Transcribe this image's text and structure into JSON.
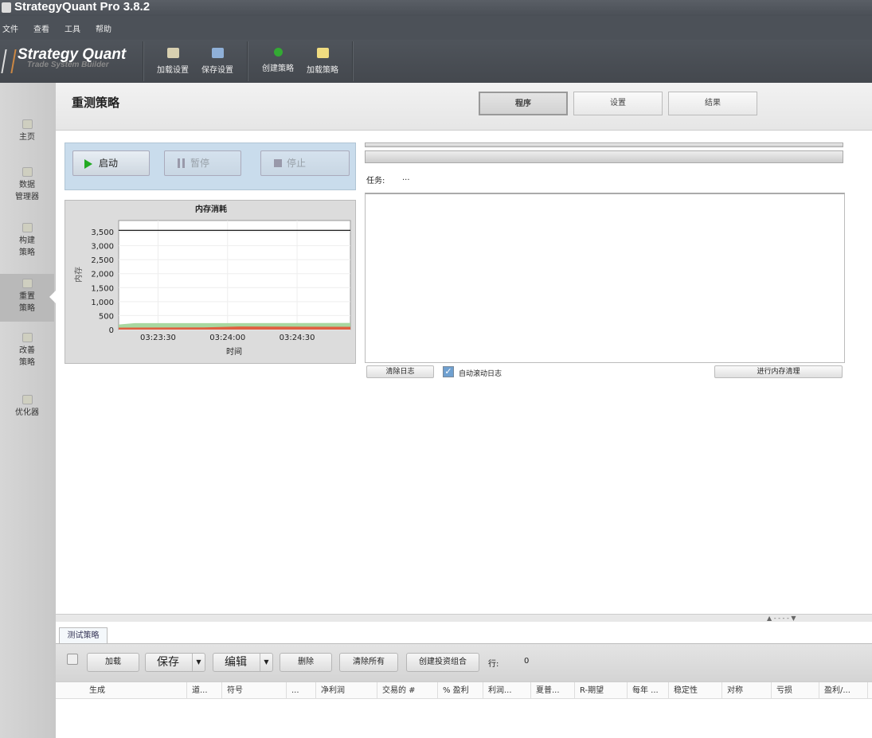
{
  "app": {
    "title": "StrategyQuant Pro  3.8.2"
  },
  "menu": [
    "文件",
    "查看",
    "工具",
    "帮助"
  ],
  "logo": {
    "name": "Strategy Quant",
    "tagline": "Trade System Builder"
  },
  "toolbar": [
    {
      "label": "加载设置",
      "icon": "folder-gear-icon"
    },
    {
      "label": "保存设置",
      "icon": "save-gear-icon"
    },
    {
      "label": "创建策略",
      "icon": "plus-circle-icon"
    },
    {
      "label": "加载策略",
      "icon": "folder-icon"
    }
  ],
  "sidebar": [
    {
      "label": "主页"
    },
    {
      "label": "数据\n管理器"
    },
    {
      "label": "构建\n策略"
    },
    {
      "label": "重置\n策略",
      "selected": true
    },
    {
      "label": "改善\n策略"
    },
    {
      "label": "优化器"
    }
  ],
  "page": {
    "title": "重测策略",
    "tabs": [
      {
        "label": "程序",
        "active": true
      },
      {
        "label": "设置"
      },
      {
        "label": "结果"
      }
    ]
  },
  "controls": {
    "start": "启动",
    "pause": "暂停",
    "stop": "停止"
  },
  "task": {
    "label": "任务:",
    "value": "..."
  },
  "log": {
    "clear": "清除日志",
    "autoscroll": "自动滚动日志",
    "autoscroll_checked": true,
    "gc": "进行内存清理"
  },
  "colors": {
    "used": "#e06040",
    "allocated": "#a8d8a0",
    "max": "#000000"
  },
  "chart_data": {
    "type": "area",
    "title": "内存消耗",
    "xlabel": "时间",
    "ylabel": "内存",
    "xlim": [
      "03:23:13",
      "03:24:53"
    ],
    "ylim": [
      0,
      3900
    ],
    "yticks": [
      "0",
      "500",
      "1,000",
      "1,500",
      "2,000",
      "2,500",
      "3,000",
      "3,500"
    ],
    "xticks": [
      "03:23:30",
      "03:24:00",
      "03:24:30"
    ],
    "series": [
      {
        "kind": "line",
        "x": [
          "03:23:13",
          "03:24:53"
        ],
        "values": [
          3550,
          3550
        ]
      },
      {
        "kind": "area",
        "x": [
          "03:23:13",
          "03:23:20",
          "03:24:00",
          "03:24:53"
        ],
        "values": [
          180,
          230,
          230,
          240
        ]
      },
      {
        "kind": "area",
        "x": [
          "03:23:13",
          "03:23:50",
          "03:24:05",
          "03:24:53"
        ],
        "values": [
          70,
          80,
          110,
          100
        ]
      }
    ],
    "grid": true
  },
  "bottom": {
    "tab": "测试策略",
    "buttons": {
      "load": "加载",
      "save": "保存",
      "edit": "编辑",
      "delete": "删除",
      "clear_all": "清除所有",
      "portfolio": "创建投资组合"
    },
    "rows_label": "行:",
    "rows_value": "0",
    "columns": [
      "生成",
      "道...",
      "符号",
      "...",
      "净利润",
      "交易的 #",
      "% 盈利",
      "利润...",
      "夏普...",
      "R-期望",
      "每年 ...",
      "稳定性",
      "对称",
      "亏损",
      "盈利/..."
    ]
  }
}
